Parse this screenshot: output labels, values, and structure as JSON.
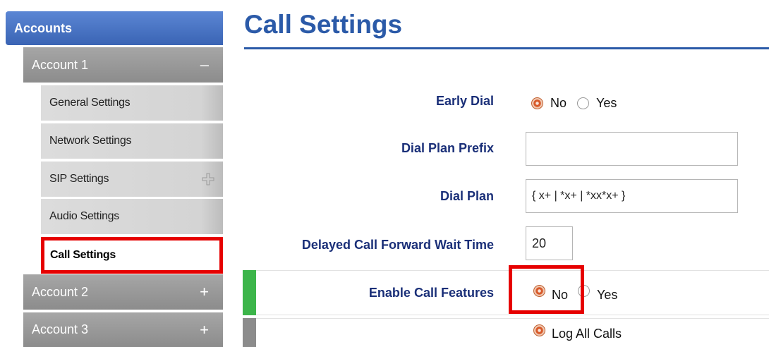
{
  "sidebar": {
    "accounts_label": "Accounts",
    "accounts": [
      {
        "label": "Account 1",
        "toggle": "–"
      },
      {
        "label": "Account 2",
        "toggle": "+"
      },
      {
        "label": "Account 3",
        "toggle": "+"
      }
    ],
    "account1_subitems": [
      {
        "label": "General Settings"
      },
      {
        "label": "Network Settings"
      },
      {
        "label": "SIP Settings"
      },
      {
        "label": "Audio Settings"
      },
      {
        "label": "Call Settings",
        "selected": true
      }
    ]
  },
  "main": {
    "title": "Call Settings",
    "early_dial": {
      "label": "Early Dial",
      "opt_no": "No",
      "opt_yes": "Yes",
      "selected": "No"
    },
    "dial_plan_prefix": {
      "label": "Dial Plan Prefix",
      "value": ""
    },
    "dial_plan": {
      "label": "Dial Plan",
      "value": "{ x+ | *x+ | *xx*x+ }"
    },
    "delayed_call_forward": {
      "label": "Delayed Call Forward Wait Time",
      "value": "20"
    },
    "enable_call_features": {
      "label": "Enable Call Features",
      "opt_no": "No",
      "opt_yes": "Yes",
      "selected": "No"
    },
    "call_log": {
      "opt_log_all": "Log All Calls",
      "selected": "Log All Calls"
    }
  },
  "colors": {
    "accent_blue": "#2b5aa8",
    "label_navy": "#1a2f78",
    "highlight_red": "#e60000",
    "status_green": "#3cb54a"
  }
}
